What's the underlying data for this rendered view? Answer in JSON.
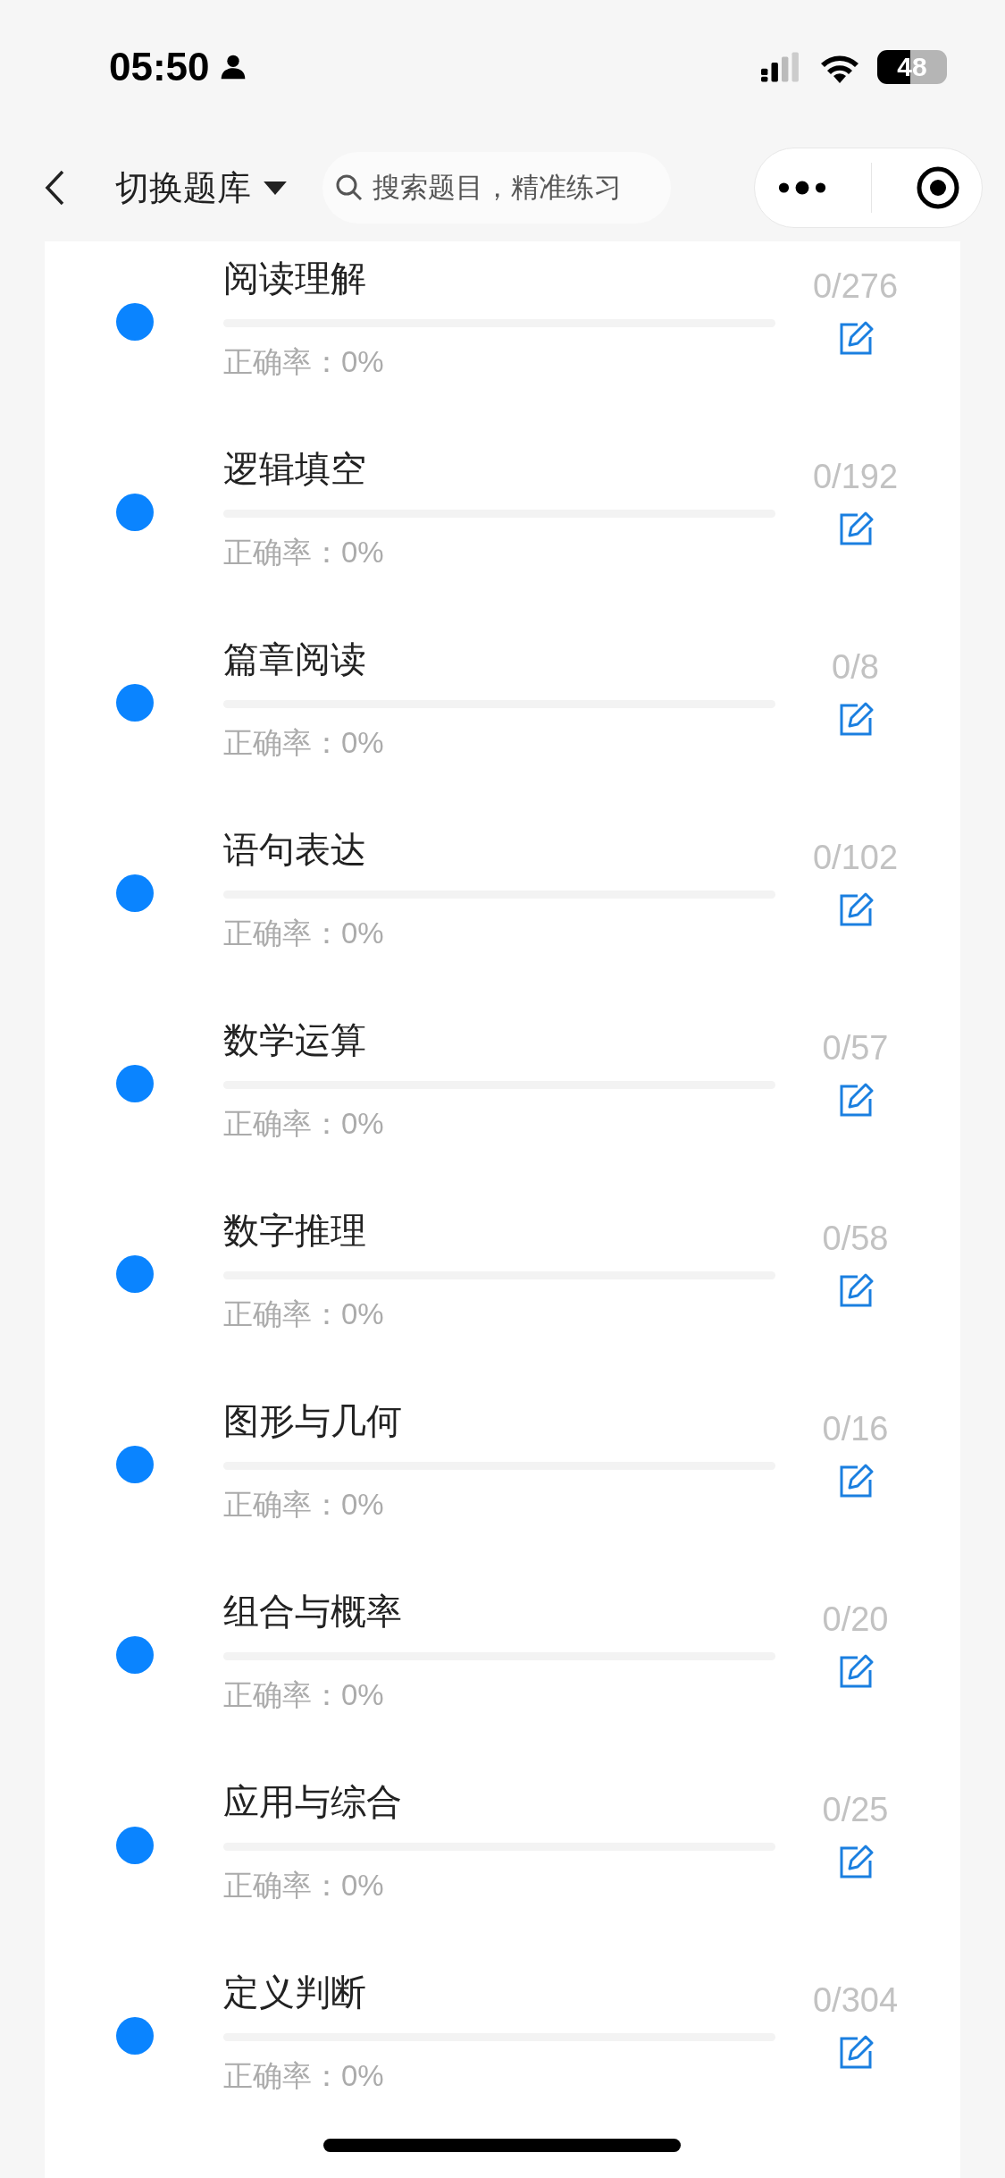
{
  "status_bar": {
    "time": "05:50",
    "battery": "48"
  },
  "nav": {
    "title": "切换题库",
    "search": {
      "placeholder": "搜索题目，精准练习"
    }
  },
  "topics": [
    {
      "name": "阅读理解",
      "accuracy": "正确率：0%",
      "count": "0/276",
      "level": 0
    },
    {
      "name": "逻辑填空",
      "accuracy": "正确率：0%",
      "count": "0/192",
      "level": 0
    },
    {
      "name": "篇章阅读",
      "accuracy": "正确率：0%",
      "count": "0/8",
      "level": 0
    },
    {
      "name": "语句表达",
      "accuracy": "正确率：0%",
      "count": "0/102",
      "level": 0
    },
    {
      "name": "数学运算",
      "accuracy": "正确率：0%",
      "count": "0/57",
      "level": 0
    },
    {
      "name": "数字推理",
      "accuracy": "正确率：0%",
      "count": "0/58",
      "level": 0
    },
    {
      "name": "图形与几何",
      "accuracy": "正确率：0%",
      "count": "0/16",
      "level": 0
    },
    {
      "name": "组合与概率",
      "accuracy": "正确率：0%",
      "count": "0/20",
      "level": 0
    },
    {
      "name": "应用与综合",
      "accuracy": "正确率：0%",
      "count": "0/25",
      "level": 0
    },
    {
      "name": "定义判断",
      "accuracy": "正确率：0%",
      "count": "0/304",
      "level": 0
    }
  ]
}
